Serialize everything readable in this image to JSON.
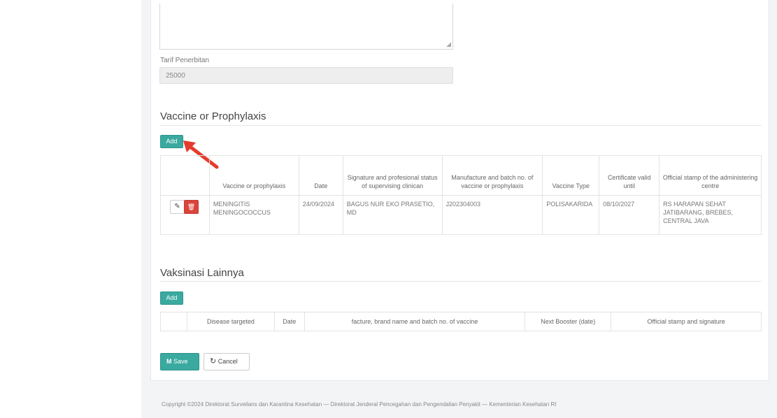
{
  "tarif": {
    "label": "Tarif Penerbitan",
    "value": "25000"
  },
  "vaccine_section": {
    "title": "Vaccine or Prophylaxis",
    "add_label": "Add",
    "columns": [
      "",
      "Vaccine or prophylaxis",
      "Date",
      "Signature and profesional status of supervising clinican",
      "Manufacture and batch no. of vaccine or prophylaxis",
      "Vaccine Type",
      "Certificate valid until",
      "Official stamp of the administering centre"
    ],
    "rows": [
      {
        "vaccine": "MENINGITIS MENINGOCOCCUS",
        "date": "24/09/2024",
        "clinician": "BAGUS NUR EKO PRASETIO, MD",
        "batch": "J202304003",
        "type": "POLISAKARIDA",
        "valid_until": "08/10/2027",
        "stamp": "RS HARAPAN SEHAT JATIBARANG, BREBES, CENTRAL JAVA"
      }
    ],
    "edit_icon": "edit-icon",
    "delete_icon": "trash-icon"
  },
  "other_section": {
    "title": "Vaksinasi Lainnya",
    "add_label": "Add",
    "columns": [
      "",
      "Disease targeted",
      "Date",
      "facture, brand name and batch no. of vaccine",
      "Next Booster (date)",
      "Official stamp and signature"
    ]
  },
  "actions": {
    "save_label": "Save",
    "cancel_label": "Cancel"
  },
  "footer": "Copyright ©2024 Direktorat Surveilans dan Karantina Kesehatan — Direktorat Jenderal Pencegahan dan Pengendalian Penyakit — Kementerian Kesehatan RI",
  "colors": {
    "primary": "#3aa99f",
    "danger": "#d9453c",
    "annotation_arrow": "#e53b2c"
  }
}
